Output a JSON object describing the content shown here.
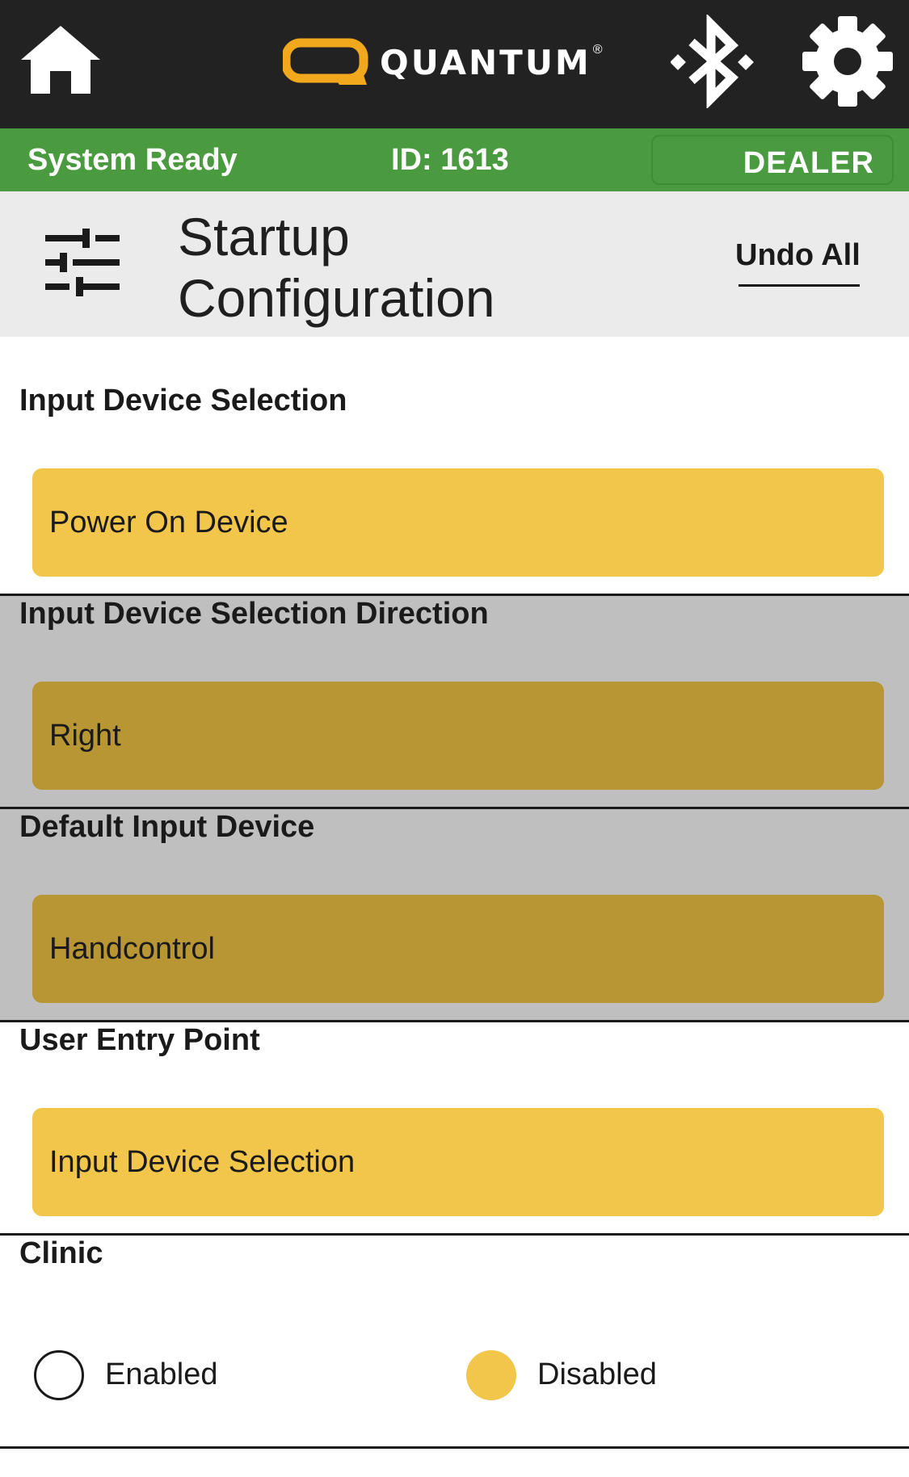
{
  "header": {
    "logo_text": "QUANTUM",
    "logo_reg": "®",
    "brand_color": "#f2a81d"
  },
  "status": {
    "text": "System Ready",
    "id": "ID: 1613",
    "role": "DEALER",
    "color": "#4a9a40"
  },
  "page": {
    "title": "Startup Configuration",
    "undo_label": "Undo All"
  },
  "sections": [
    {
      "label": "Input Device Selection",
      "value": "Power On Device",
      "enabled": true
    },
    {
      "label": "Input Device Selection Direction",
      "value": "Right",
      "enabled": false
    },
    {
      "label": "Default Input Device",
      "value": "Handcontrol",
      "enabled": false
    },
    {
      "label": "User Entry Point",
      "value": "Input Device Selection",
      "enabled": true
    }
  ],
  "clinic": {
    "label": "Clinic",
    "options": [
      {
        "label": "Enabled",
        "selected": false
      },
      {
        "label": "Disabled",
        "selected": true
      }
    ]
  },
  "colors": {
    "accent": "#f2c64a",
    "accent_dim": "#b89634",
    "dim_bg": "#bfbfbf"
  }
}
